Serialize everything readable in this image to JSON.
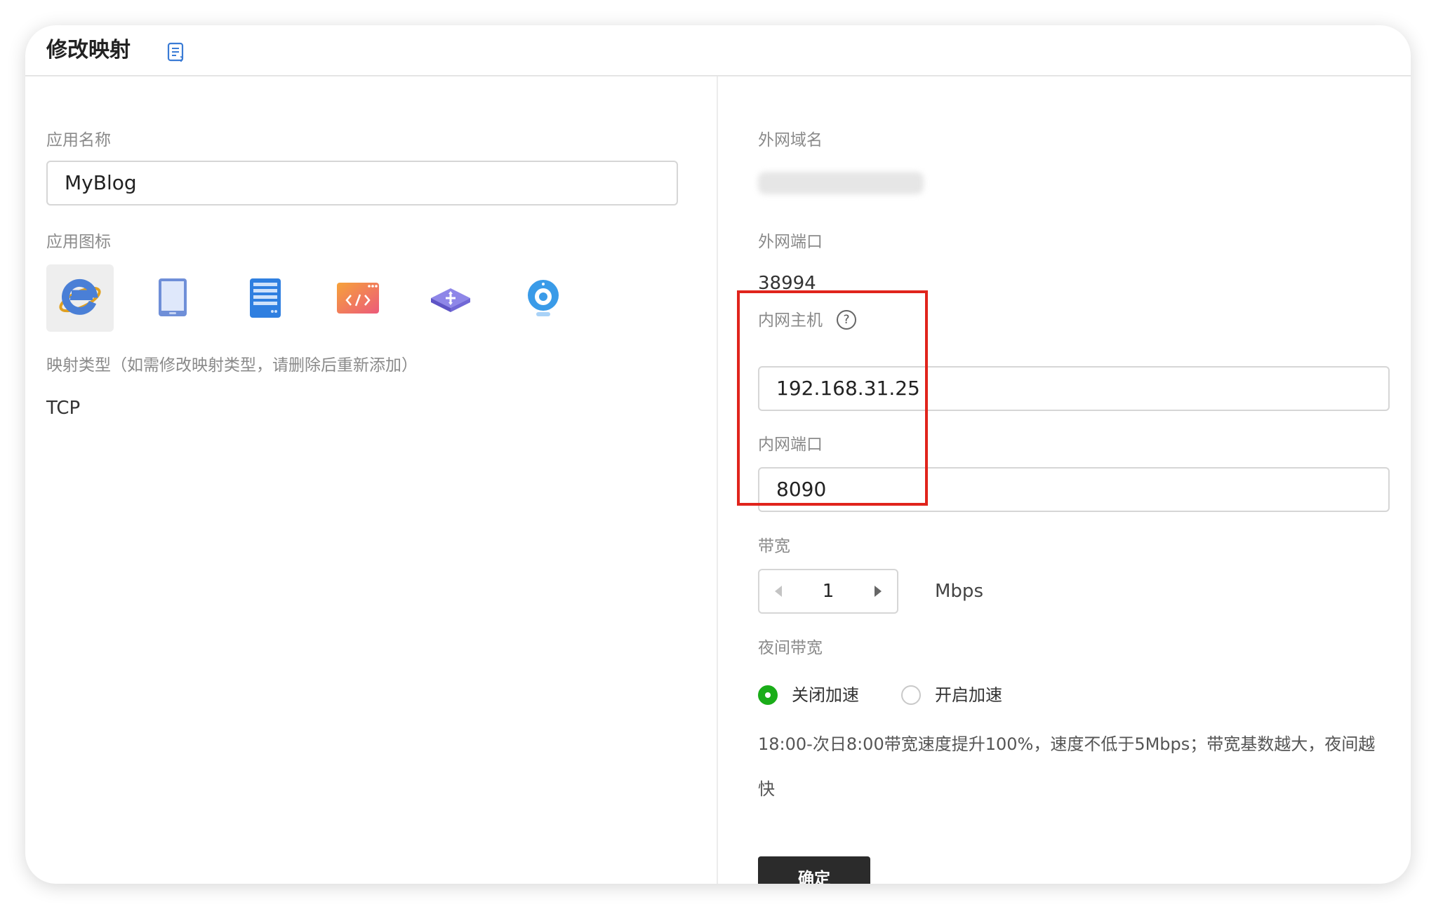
{
  "header": {
    "title": "修改映射"
  },
  "left": {
    "app_name_label": "应用名称",
    "app_name_value": "MyBlog",
    "app_icon_label": "应用图标",
    "icons": [
      "ie-browser-icon",
      "tablet-icon",
      "server-icon",
      "code-window-icon",
      "router-icon",
      "webcam-icon"
    ],
    "selected_icon": "ie-browser-icon",
    "mapping_type_label": "映射类型（如需修改映射类型，请删除后重新添加）",
    "mapping_type_value": "TCP"
  },
  "right": {
    "domain_label": "外网域名",
    "domain_value": "",
    "ext_port_label": "外网端口",
    "ext_port_value": "38994",
    "lan_host_label": "内网主机",
    "lan_host_value": "192.168.31.25",
    "lan_port_label": "内网端口",
    "lan_port_value": "8090",
    "bandwidth_label": "带宽",
    "bandwidth_value": "1",
    "bandwidth_unit": "Mbps",
    "night_label": "夜间带宽",
    "night_options": [
      "关闭加速",
      "开启加速"
    ],
    "night_selected": "关闭加速",
    "night_note": "18:00-次日8:00带宽速度提升100%，速度不低于5Mbps；带宽基数越大，夜间越快",
    "confirm_label": "确定"
  },
  "colors": {
    "accent_green": "#1aad19",
    "highlight_red": "#e0241c",
    "button_dark": "#2b2b2b"
  }
}
